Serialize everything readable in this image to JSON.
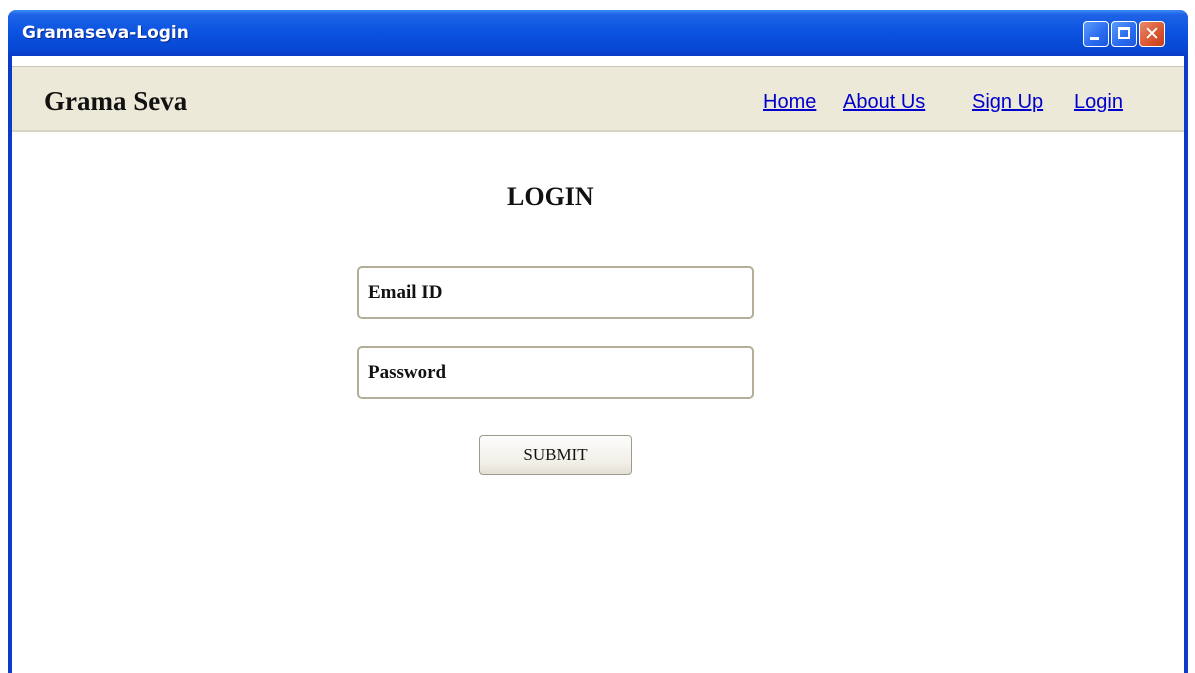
{
  "window": {
    "title": "Gramaseva-Login",
    "controls": {
      "minimize": "minimize-icon",
      "maximize": "maximize-icon",
      "close": "close-icon"
    },
    "titlebar_color": "#0a52e0"
  },
  "navbar": {
    "brand": "Grama Seva",
    "links": [
      {
        "label": "Home"
      },
      {
        "label": "About Us"
      },
      {
        "label": "Sign Up"
      },
      {
        "label": "Login"
      }
    ],
    "background": "#ece9d8",
    "link_color": "#0000cc"
  },
  "login": {
    "heading": "LOGIN",
    "email": {
      "placeholder": "Email ID",
      "value": ""
    },
    "password": {
      "placeholder": "Password",
      "value": ""
    },
    "submit_label": "SUBMIT"
  }
}
